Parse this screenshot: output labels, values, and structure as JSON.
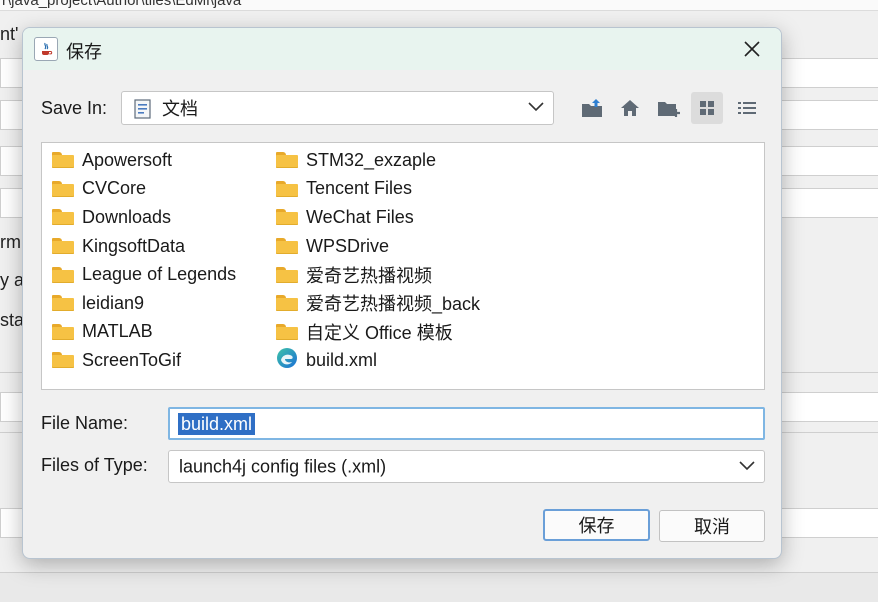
{
  "background": {
    "top_path": "r\\java_project\\Author\\tiles\\EdMi\\java",
    "fragments": [
      "nt'",
      "rm",
      "y a",
      "sta"
    ]
  },
  "dialog": {
    "title": "保存",
    "close_icon": "close-icon",
    "save_in_label": "Save In:",
    "save_in_value": "文档",
    "toolbar_icons": [
      "up-folder-icon",
      "home-icon",
      "new-folder-icon",
      "list-view-icon",
      "details-view-icon"
    ],
    "files_col1": [
      {
        "name": "Apowersoft",
        "icon": "folder-icon"
      },
      {
        "name": "CVCore",
        "icon": "folder-icon"
      },
      {
        "name": "Downloads",
        "icon": "folder-icon"
      },
      {
        "name": "KingsoftData",
        "icon": "folder-icon"
      },
      {
        "name": "League of Legends",
        "icon": "folder-icon"
      },
      {
        "name": "leidian9",
        "icon": "folder-icon"
      },
      {
        "name": "MATLAB",
        "icon": "folder-icon"
      },
      {
        "name": "ScreenToGif",
        "icon": "folder-icon"
      }
    ],
    "files_col2": [
      {
        "name": "STM32_exzaple",
        "icon": "folder-icon"
      },
      {
        "name": "Tencent Files",
        "icon": "folder-icon"
      },
      {
        "name": "WeChat Files",
        "icon": "folder-icon"
      },
      {
        "name": "WPSDrive",
        "icon": "folder-icon"
      },
      {
        "name": "爱奇艺热播视频",
        "icon": "folder-icon"
      },
      {
        "name": "爱奇艺热播视频_back",
        "icon": "folder-icon"
      },
      {
        "name": "自定义 Office 模板",
        "icon": "folder-icon"
      },
      {
        "name": "build.xml",
        "icon": "edge-file-icon"
      }
    ],
    "file_name_label": "File Name:",
    "file_name_value": "build.xml",
    "file_type_label": "Files of Type:",
    "file_type_value": "launch4j config files (.xml)",
    "save_button": "保存",
    "cancel_button": "取消"
  },
  "colors": {
    "accent": "#2f6fc5",
    "folder": "#f6c244",
    "titlebar": "#e8f4ef"
  }
}
